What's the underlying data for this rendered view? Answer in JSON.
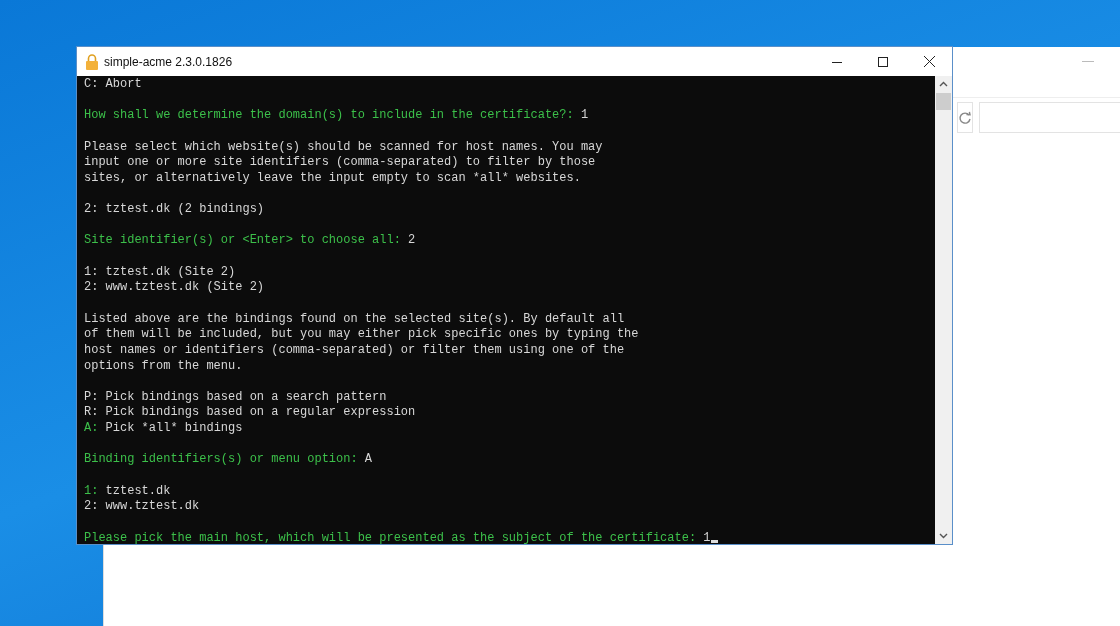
{
  "window": {
    "title": "simple-acme 2.3.0.1826"
  },
  "console": {
    "blocks": [
      [
        [
          {
            "kind": "output",
            "text": "C: Abort"
          }
        ]
      ],
      [
        [
          {
            "kind": "prompt",
            "text": "How shall we determine the domain(s) to include in the certificate?: "
          },
          {
            "kind": "output",
            "text": "1"
          }
        ]
      ],
      [
        [
          {
            "kind": "output",
            "text": "Please select which website(s) should be scanned for host names. You may"
          }
        ],
        [
          {
            "kind": "output",
            "text": "input one or more site identifiers (comma-separated) to filter by those"
          }
        ],
        [
          {
            "kind": "output",
            "text": "sites, or alternatively leave the input empty to scan *all* websites."
          }
        ]
      ],
      [
        [
          {
            "kind": "output",
            "text": "2: tztest.dk (2 bindings)"
          }
        ]
      ],
      [
        [
          {
            "kind": "prompt",
            "text": "Site identifier(s) or <Enter> to choose all: "
          },
          {
            "kind": "output",
            "text": "2"
          }
        ]
      ],
      [
        [
          {
            "kind": "output",
            "text": "1: tztest.dk (Site 2)"
          }
        ],
        [
          {
            "kind": "output",
            "text": "2: www.tztest.dk (Site 2)"
          }
        ]
      ],
      [
        [
          {
            "kind": "output",
            "text": "Listed above are the bindings found on the selected site(s). By default all"
          }
        ],
        [
          {
            "kind": "output",
            "text": "of them will be included, but you may either pick specific ones by typing the"
          }
        ],
        [
          {
            "kind": "output",
            "text": "host names or identifiers (comma-separated) or filter them using one of the"
          }
        ],
        [
          {
            "kind": "output",
            "text": "options from the menu."
          }
        ]
      ],
      [
        [
          {
            "kind": "output",
            "text": "P: Pick bindings based on a search pattern"
          }
        ],
        [
          {
            "kind": "output",
            "text": "R: Pick bindings based on a regular expression"
          }
        ],
        [
          {
            "kind": "prompt",
            "text": "A:"
          },
          {
            "kind": "output",
            "text": " Pick *all* bindings"
          }
        ]
      ],
      [
        [
          {
            "kind": "prompt",
            "text": "Binding identifiers(s) or menu option: "
          },
          {
            "kind": "output",
            "text": "A"
          }
        ]
      ],
      [
        [
          {
            "kind": "prompt",
            "text": "1:"
          },
          {
            "kind": "output",
            "text": " tztest.dk"
          }
        ],
        [
          {
            "kind": "output",
            "text": "2: www.tztest.dk"
          }
        ]
      ],
      [
        [
          {
            "kind": "prompt",
            "text": "Please pick the main host, which will be presented as the subject of the certificate: "
          },
          {
            "kind": "output",
            "text": "1"
          }
        ]
      ]
    ]
  }
}
